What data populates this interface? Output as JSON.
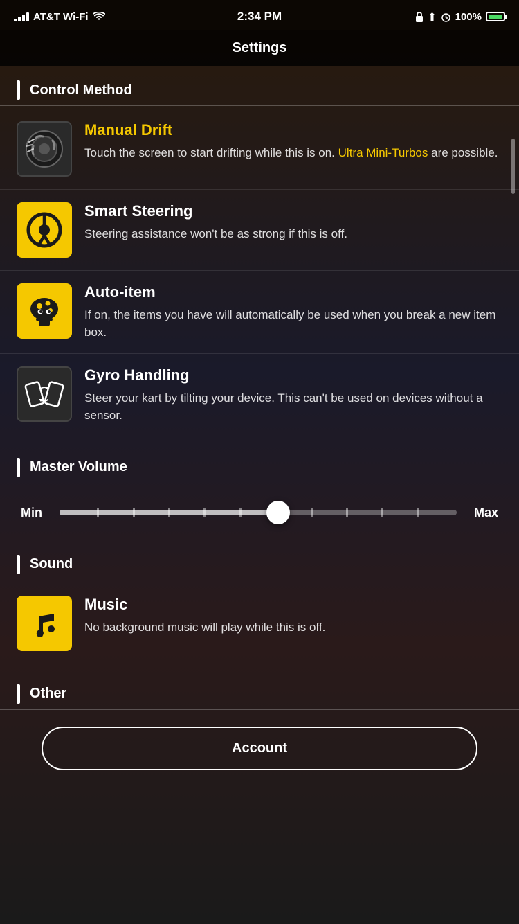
{
  "statusBar": {
    "carrier": "AT&T Wi-Fi",
    "time": "2:34 PM",
    "battery": "100%",
    "batteryFull": true
  },
  "header": {
    "title": "Settings"
  },
  "sections": [
    {
      "id": "control-method",
      "title": "Control Method",
      "items": [
        {
          "id": "manual-drift",
          "name": "Manual Drift",
          "nameColor": "yellow",
          "iconType": "dark",
          "description": "Touch the screen to start drifting while this is on.",
          "highlight": "Ultra Mini-Turbos",
          "descriptionEnd": " are possible."
        },
        {
          "id": "smart-steering",
          "name": "Smart Steering",
          "nameColor": "white",
          "iconType": "yellow",
          "description": "Steering assistance won't be as strong if this is off."
        },
        {
          "id": "auto-item",
          "name": "Auto-item",
          "nameColor": "white",
          "iconType": "yellow",
          "description": "If on, the items you have will automatically be used when you break a new item box."
        },
        {
          "id": "gyro-handling",
          "name": "Gyro Handling",
          "nameColor": "white",
          "iconType": "dark",
          "description": "Steer your kart by tilting your device. This can't be used on devices without a sensor."
        }
      ]
    },
    {
      "id": "master-volume",
      "title": "Master Volume",
      "minLabel": "Min",
      "maxLabel": "Max",
      "sliderValue": 55
    },
    {
      "id": "sound",
      "title": "Sound",
      "items": [
        {
          "id": "music",
          "name": "Music",
          "nameColor": "white",
          "iconType": "yellow",
          "description": "No background music will play while this is off."
        }
      ]
    },
    {
      "id": "other",
      "title": "Other"
    }
  ],
  "accountButton": {
    "label": "Account"
  }
}
